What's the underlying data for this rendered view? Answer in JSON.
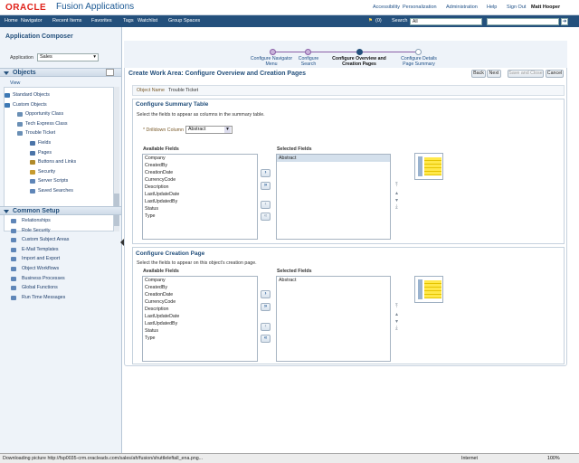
{
  "brand": {
    "logo": "ORACLE",
    "product": "Fusion Applications"
  },
  "toplinks": {
    "accessibility": "Accessibility",
    "personalization": "Personalization",
    "administration": "Administration",
    "help": "Help",
    "signout": "Sign Out",
    "user": "Matt Hooper"
  },
  "nav": {
    "home": "Home",
    "navigator": "Navigator",
    "recent": "Recent Items",
    "favorites": "Favorites",
    "tags": "Tags",
    "watchlist": "Watchlist",
    "groupspaces": "Group Spaces",
    "count": "(0)",
    "search_label": "Search",
    "search_scope": "All"
  },
  "left": {
    "title": "Application Composer",
    "app_label": "Application",
    "app_value": "Sales",
    "objects": "Objects",
    "view": "View",
    "tree": [
      "Standard Objects",
      "Custom Objects",
      "Opportunity Class",
      "Tech Express Class",
      "Trouble Ticket",
      "Fields",
      "Pages",
      "Buttons and Links",
      "Security",
      "Server Scripts",
      "Saved Searches"
    ],
    "common_setup": "Common Setup",
    "setup": [
      "Relationships",
      "Role Security",
      "Custom Subject Areas",
      "E-Mail Templates",
      "Import and Export",
      "Object Workflows",
      "Business Processes",
      "Global Functions",
      "Run Time Messages"
    ]
  },
  "train": {
    "s1": "Configure Navigator Menu",
    "s2": "Configure Search",
    "s3": "Configure Overview and Creation Pages",
    "s4": "Configure Details Page Summary"
  },
  "page": {
    "title": "Create Work Area: Configure Overview and Creation Pages",
    "back": "Back",
    "next": "Next",
    "save_close": "Save and Close",
    "cancel": "Cancel",
    "obj_label": "Object Name",
    "obj_value": "Trouble Ticket"
  },
  "summary": {
    "title": "Configure Summary Table",
    "desc": "Select the fields to appear as columns in the summary table.",
    "drill_label": "* Drilldown Column",
    "drill_value": "Abstract",
    "avail_label": "Available Fields",
    "sel_label": "Selected Fields",
    "available": [
      "Company",
      "CreatedBy",
      "CreationDate",
      "CurrencyCode",
      "Description",
      "LastUpdateDate",
      "LastUpdatedBy",
      "Status",
      "Type"
    ],
    "selected": [
      "Abstract"
    ]
  },
  "creation": {
    "title": "Configure Creation Page",
    "desc": "Select the fields to appear on this object's creation page.",
    "avail_label": "Available Fields",
    "sel_label": "Selected Fields",
    "available": [
      "Company",
      "CreatedBy",
      "CreationDate",
      "CurrencyCode",
      "Description",
      "LastUpdateDate",
      "LastUpdatedBy",
      "Status",
      "Type"
    ],
    "selected": [
      "Abstract"
    ]
  },
  "status": {
    "text": "Downloading picture http://fsp0035-crm.oracleads.com/sales/afr/fusion/shuttleleftall_ena.png...",
    "zone": "Internet",
    "zoom": "100%"
  }
}
